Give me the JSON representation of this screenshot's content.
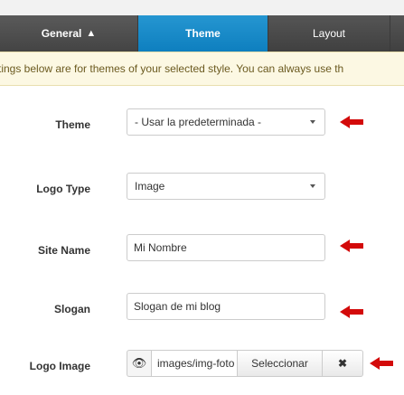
{
  "tabs": {
    "general": "General",
    "theme": "Theme",
    "layout": "Layout"
  },
  "icons": {
    "warning": "warning-icon",
    "eye": "eye-icon",
    "chevron": "chevron-down-icon",
    "clear": "clear-icon",
    "arrow": "arrow-left-icon"
  },
  "colors": {
    "active_tab": "#1589c9",
    "arrow": "#d30a0a",
    "notice_bg": "#fcf8e3"
  },
  "notice": {
    "text": "tings below are for themes of your selected style. You can always use th"
  },
  "form": {
    "theme": {
      "label": "Theme",
      "value": "- Usar la predeterminada -"
    },
    "logo_type": {
      "label": "Logo Type",
      "value": "Image"
    },
    "site_name": {
      "label": "Site Name",
      "value": "Mi Nombre"
    },
    "slogan": {
      "label": "Slogan",
      "value": "Slogan de mi blog"
    },
    "logo_image": {
      "label": "Logo Image",
      "eye_glyph": "👁",
      "path": "images/img-foto",
      "select_label": "Seleccionar",
      "clear_glyph": "✖"
    }
  },
  "glyphs": {
    "warning": "▲"
  }
}
